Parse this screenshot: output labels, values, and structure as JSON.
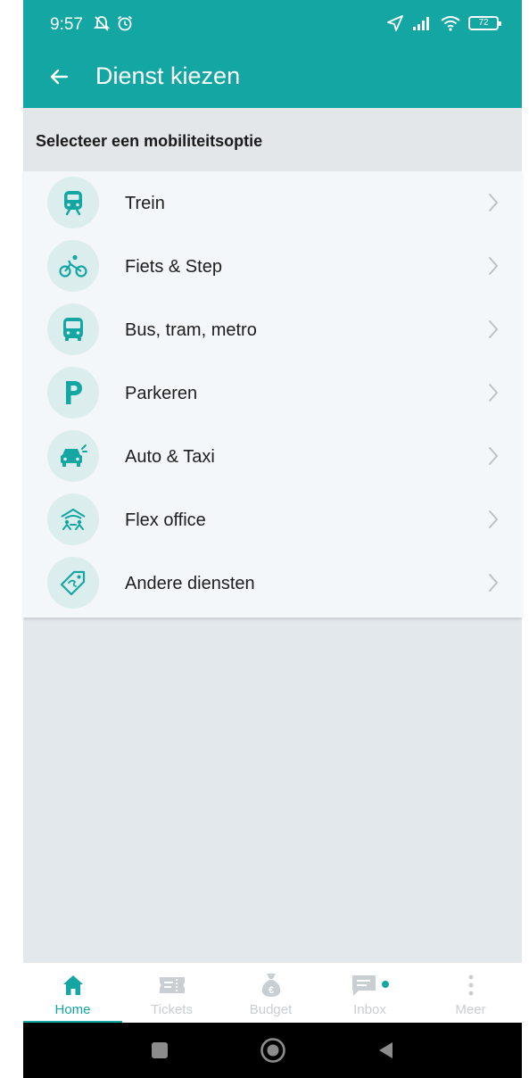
{
  "status_bar": {
    "time": "9:57",
    "icons_left": [
      "mute-notifications-icon",
      "alarm-icon"
    ],
    "icons_right": [
      "location-arrow-icon",
      "signal-icon",
      "wifi-icon"
    ],
    "battery": "72"
  },
  "app_bar": {
    "title": "Dienst kiezen",
    "back_icon": "arrow-left-icon"
  },
  "section": {
    "title": "Selecteer een mobiliteitsoptie"
  },
  "services": [
    {
      "label": "Trein",
      "icon": "train-icon"
    },
    {
      "label": "Fiets & Step",
      "icon": "bicycle-icon"
    },
    {
      "label": "Bus, tram, metro",
      "icon": "bus-icon"
    },
    {
      "label": "Parkeren",
      "icon": "parking-icon"
    },
    {
      "label": "Auto & Taxi",
      "icon": "car-icon"
    },
    {
      "label": "Flex office",
      "icon": "flex-office-icon"
    },
    {
      "label": "Andere diensten",
      "icon": "price-tag-icon"
    }
  ],
  "bottom_nav": {
    "tabs": [
      {
        "label": "Home",
        "icon": "home-icon",
        "active": true
      },
      {
        "label": "Tickets",
        "icon": "ticket-icon",
        "active": false
      },
      {
        "label": "Budget",
        "icon": "money-bag-icon",
        "active": false
      },
      {
        "label": "Inbox",
        "icon": "chat-icon",
        "active": false,
        "unread_dot": true
      },
      {
        "label": "Meer",
        "icon": "more-vertical-icon",
        "active": false
      }
    ]
  },
  "colors": {
    "accent": "#13a6a3",
    "icon_bg": "#dcedee",
    "inactive": "#c9ced3",
    "background": "#e3e8ec"
  }
}
